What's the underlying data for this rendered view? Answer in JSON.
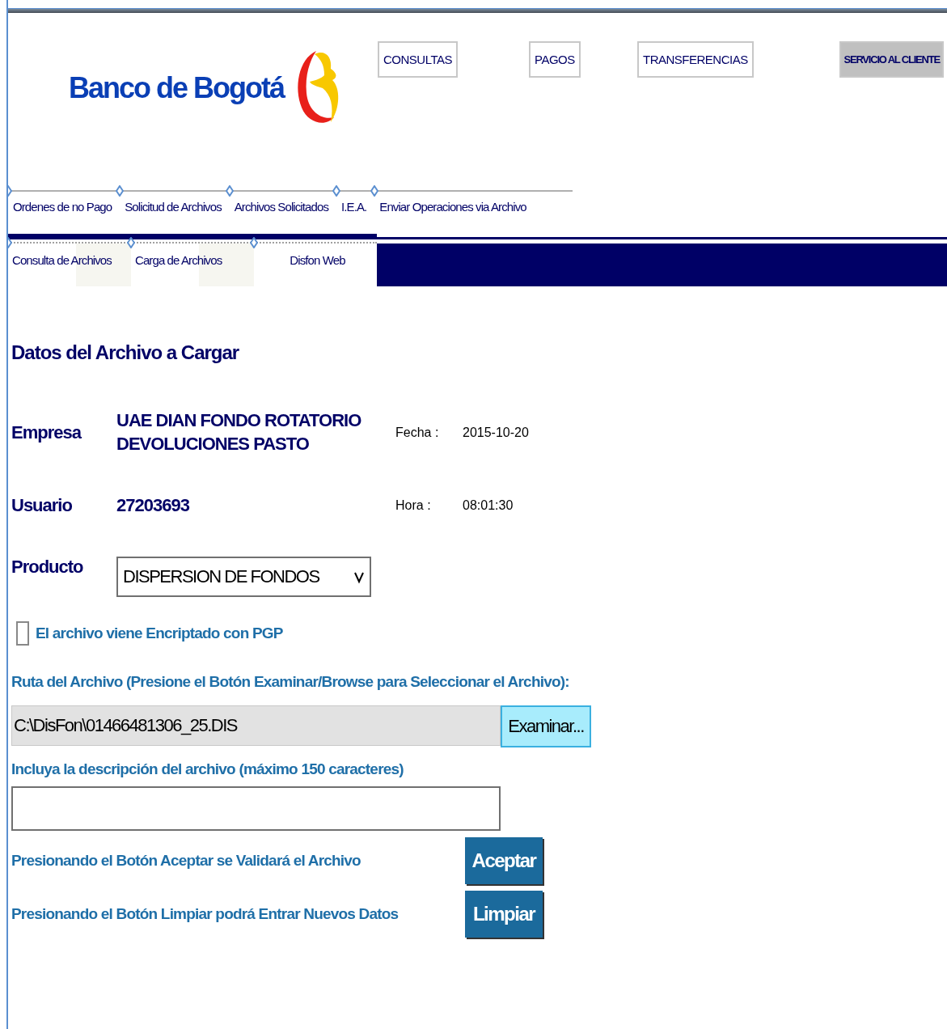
{
  "logo": {
    "text": "Banco de Bogotá"
  },
  "top_nav": [
    {
      "label": "CONSULTAS",
      "selected": false
    },
    {
      "label": "PAGOS",
      "selected": false
    },
    {
      "label": "TRANSFERENCIAS",
      "selected": false
    },
    {
      "label": "SERVICIO AL CLIENTE",
      "selected": true
    }
  ],
  "menu": [
    {
      "label": "Ordenes de no Pago"
    },
    {
      "label": "Solicitud de Archivos"
    },
    {
      "label": "Archivos Solicitados"
    },
    {
      "label": "I.E.A."
    },
    {
      "label": "Enviar Operaciones via Archivo"
    }
  ],
  "submenu": [
    {
      "label": "Consulta de Archivos"
    },
    {
      "label": "Carga de Archivos"
    },
    {
      "label": "Disfon Web"
    }
  ],
  "form": {
    "title": "Datos del Archivo a Cargar",
    "empresa": {
      "label": "Empresa",
      "value": "UAE DIAN FONDO ROTATORIO DEVOLUCIONES PASTO",
      "side_label": "Fecha :",
      "side_value": "2015-10-20"
    },
    "usuario": {
      "label": "Usuario",
      "value": "27203693",
      "side_label": "Hora :",
      "side_value": "08:01:30"
    },
    "producto": {
      "label": "Producto",
      "value": "DISPERSION DE FONDOS"
    },
    "pgp": {
      "label": "El archivo viene Encriptado con PGP",
      "checked": false
    },
    "ruta_label": "Ruta del Archivo (Presione el Botón Examinar/Browse para Seleccionar el Archivo):",
    "ruta_value": "C:\\DisFon\\01466481306_25.DIS",
    "browse_button": "Examinar...",
    "descripcion_label": "Incluya la descripción del archivo (máximo 150 caracteres)",
    "actions": [
      {
        "text": "Presionando el Botón Aceptar se Validará el Archivo",
        "button": "Aceptar"
      },
      {
        "text": "Presionando el Botón Limpiar podrá Entrar Nuevos Datos",
        "button": "Limpiar"
      }
    ]
  }
}
